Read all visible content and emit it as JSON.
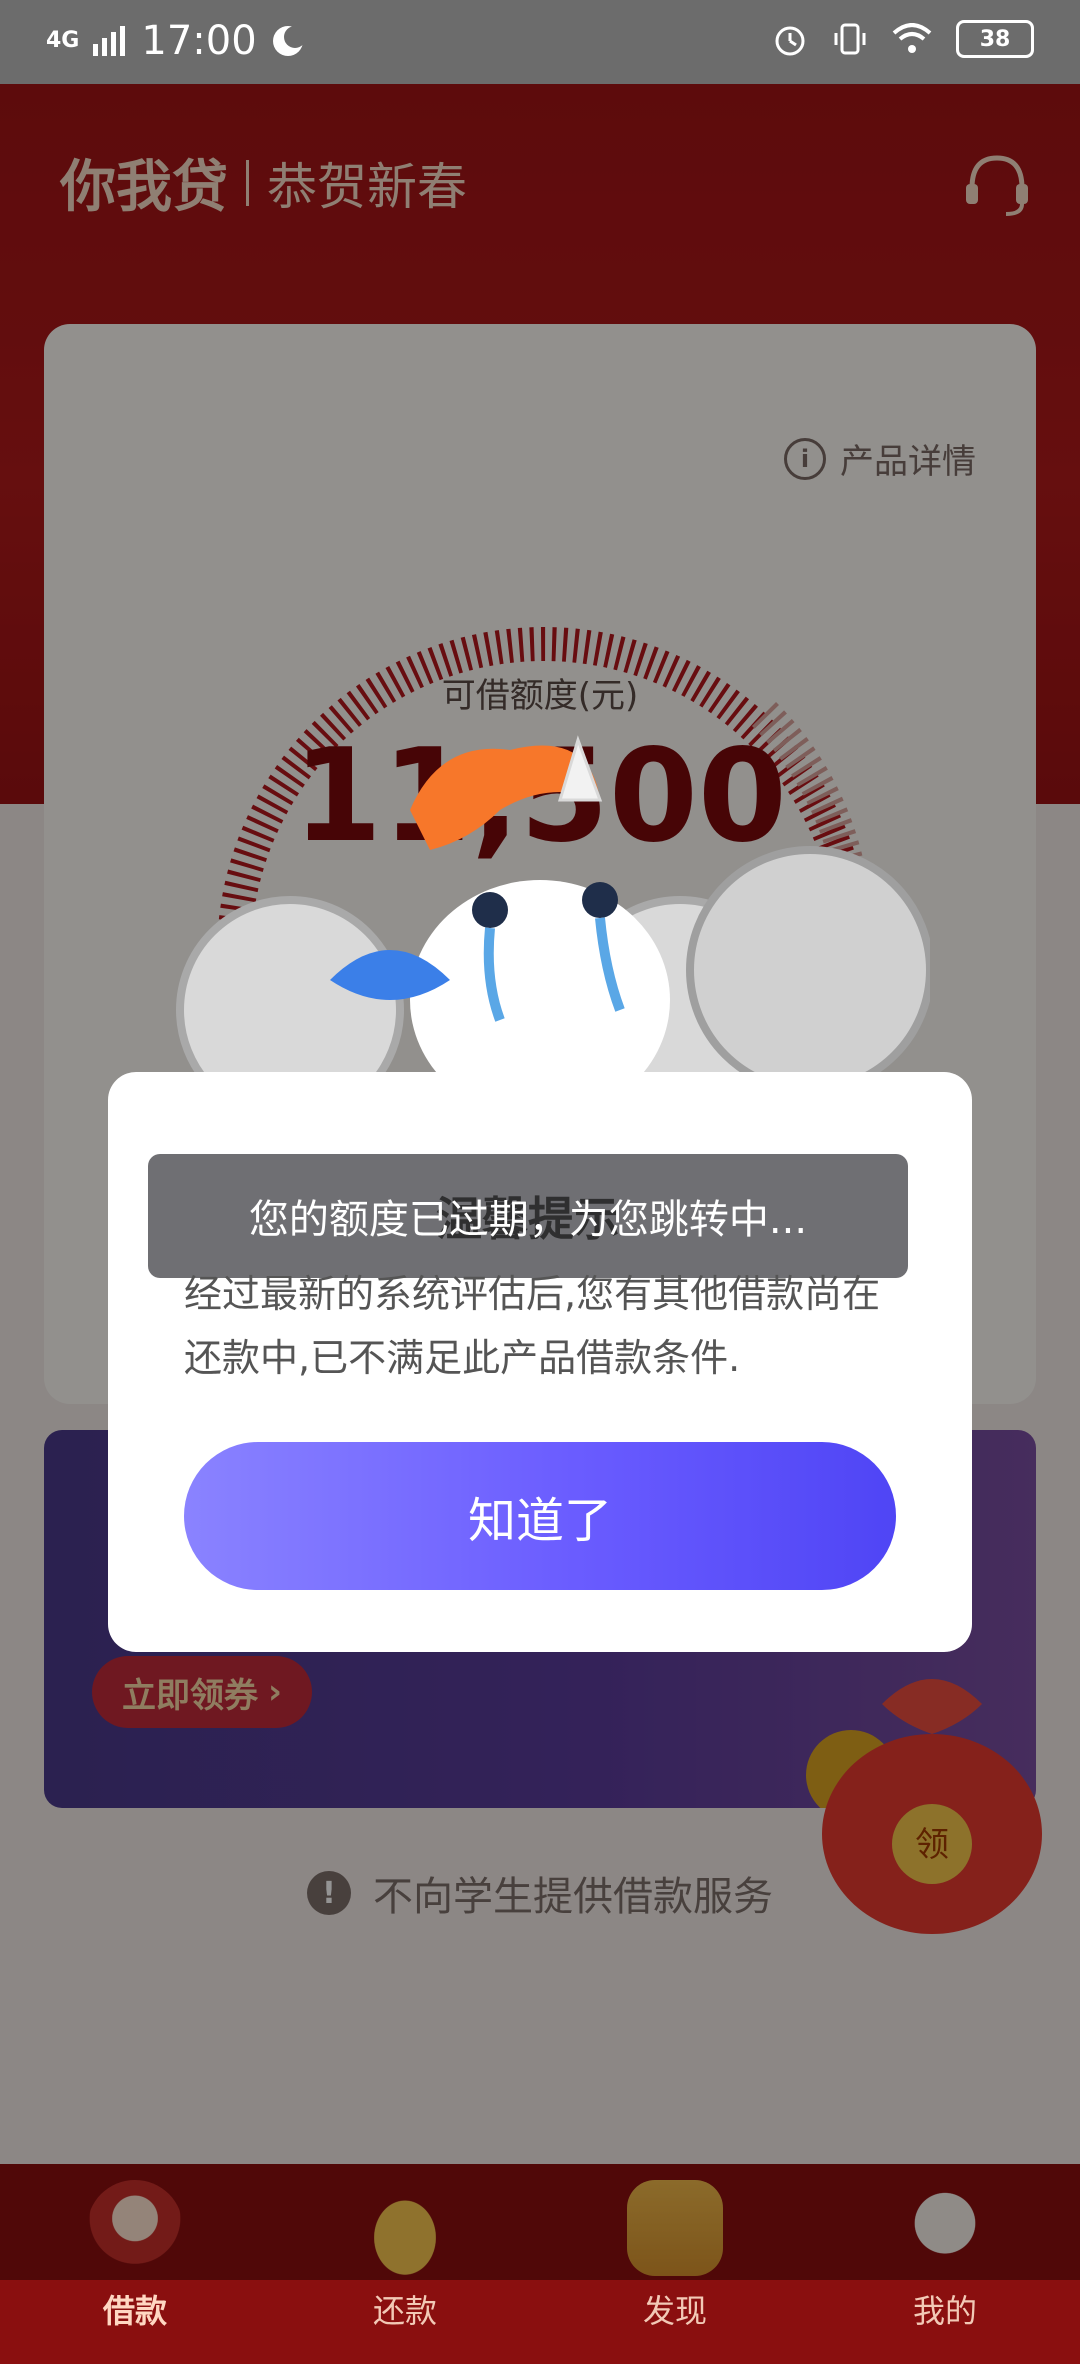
{
  "status_bar": {
    "network": "4G",
    "time": "17:00",
    "battery": "38"
  },
  "header": {
    "brand": "你我贷",
    "subtitle": "恭贺新春"
  },
  "card": {
    "detail_link": "产品详情",
    "amount_label": "可借额度(元)",
    "amount": "11,500"
  },
  "promo": {
    "button_label": "立即领券"
  },
  "notice": {
    "text": "不向学生提供借款服务"
  },
  "red_bag": {
    "label": "领"
  },
  "nav": {
    "items": [
      {
        "label": "借款",
        "active": true
      },
      {
        "label": "还款"
      },
      {
        "label": "发现"
      },
      {
        "label": "我的"
      }
    ]
  },
  "dialog": {
    "title_overlay": "您的额度已过期，为您跳转中...",
    "title_behind": "温馨提示",
    "message": "经过最新的系统评估后,您有其他借款尚在还款中,已不满足此产品借款条件.",
    "button": "知道了"
  }
}
